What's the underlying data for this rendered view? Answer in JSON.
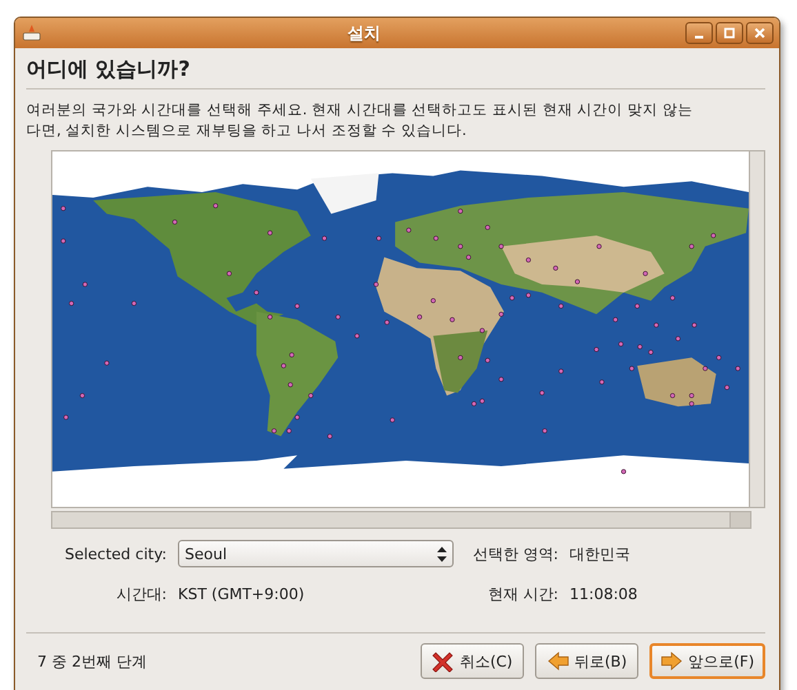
{
  "window": {
    "title": "설치"
  },
  "heading": "어디에 있습니까?",
  "description": "여러분의 국가와 시간대를 선택해 주세요. 현재 시간대를 선택하고도 표시된 현재 시간이 맞지 않는 다면, 설치한 시스템으로 재부팅을 하고 나서 조정할 수 있습니다.",
  "city": {
    "label": "Selected city:",
    "value": "Seoul"
  },
  "region": {
    "label": "선택한 영역:",
    "value": "대한민국"
  },
  "timezone": {
    "label": "시간대:",
    "value": "KST (GMT+9:00)"
  },
  "current_time": {
    "label": "현재 시간:",
    "value": "11:08:08"
  },
  "step": "7 중 2번째 단계",
  "buttons": [
    {
      "kind": "cancel",
      "label": "취소(C)",
      "focused": false
    },
    {
      "kind": "back",
      "label": "뒤로(B)",
      "focused": false
    },
    {
      "kind": "forward",
      "label": "앞으로(F)",
      "focused": true
    }
  ]
}
